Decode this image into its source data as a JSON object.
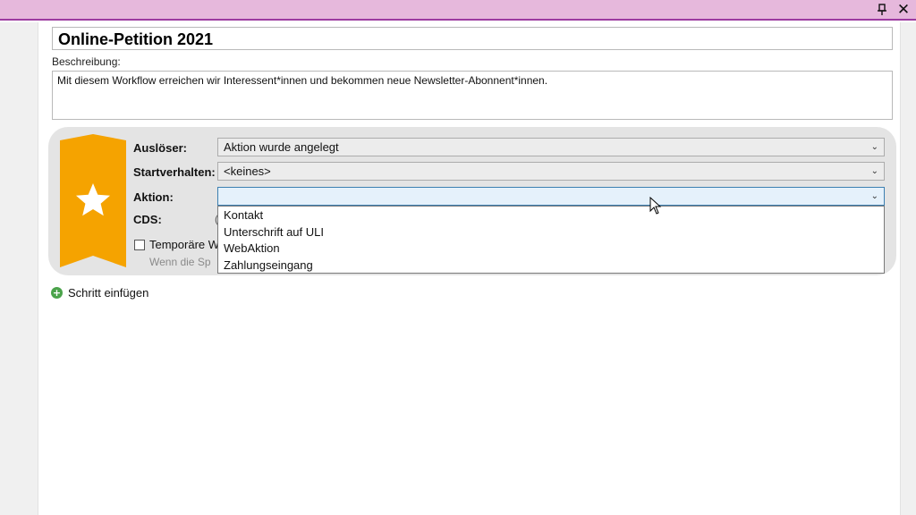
{
  "window": {
    "pin_glyph": "⊥",
    "close_glyph": "✕"
  },
  "workflow": {
    "title": "Online-Petition 2021",
    "description_label": "Beschreibung:",
    "description": "Mit diesem Workflow erreichen wir Interessent*innen und bekommen neue Newsletter-Abonnent*innen."
  },
  "step": {
    "trigger_label": "Auslöser:",
    "trigger_value": "Aktion wurde angelegt",
    "start_label": "Startverhalten:",
    "start_value": "<keines>",
    "action_label": "Aktion:",
    "action_value": "",
    "cds_label": "CDS:",
    "cds_partial": "(",
    "temp_checkbox_label": "Temporäre W",
    "hint_partial": "Wenn die Sp",
    "chevron": "⌄"
  },
  "action_dropdown": {
    "options": [
      "Kontakt",
      "Unterschrift auf ULI",
      "WebAktion",
      "Zahlungseingang"
    ]
  },
  "add_step": {
    "label": "Schritt einfügen",
    "icon": "+"
  },
  "colors": {
    "titlebar": "#e6b8dc",
    "ribbon": "#f5a300",
    "accent_active": "#3c7fb1"
  }
}
